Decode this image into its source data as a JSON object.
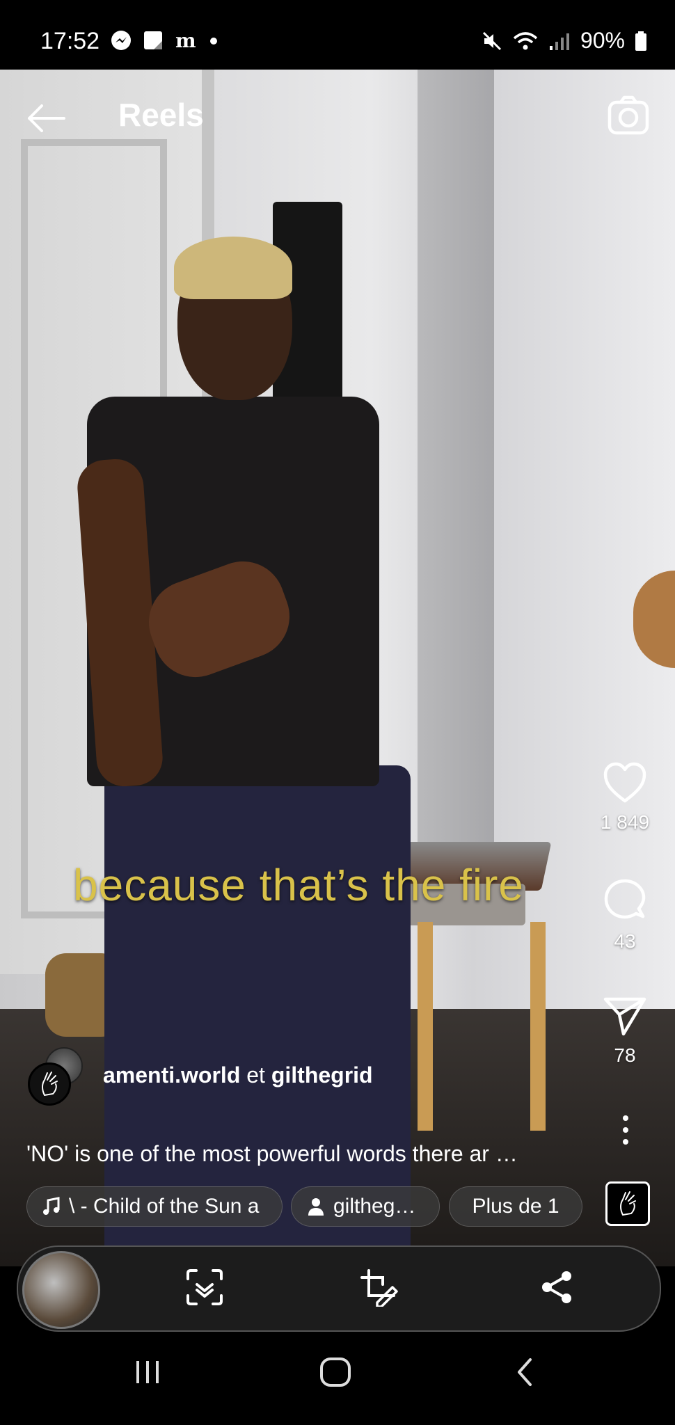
{
  "status_bar": {
    "time": "17:52",
    "app_icons": [
      "messenger-icon",
      "notes-icon",
      "m-icon",
      "dot-icon"
    ],
    "battery": "90%",
    "system_icons": [
      "mute-icon",
      "wifi-icon",
      "signal-icon",
      "battery-icon"
    ]
  },
  "header": {
    "title": "Reels"
  },
  "video": {
    "subtitle": "because that’s the fire"
  },
  "actions": {
    "likes": "1 849",
    "comments": "43",
    "shares": "78"
  },
  "author": {
    "primary": "amenti.world",
    "joiner": "et",
    "secondary": "gilthegrid"
  },
  "caption": "'NO' is one of the most powerful words there ar …",
  "chips": {
    "music": "\\ - Child of the Sun  a",
    "user": "giltheg…",
    "more": "Plus de 1"
  },
  "colors": {
    "subtitle": "#d9c24a",
    "background": "#000000",
    "chip_bg": "#3c3c3c"
  }
}
